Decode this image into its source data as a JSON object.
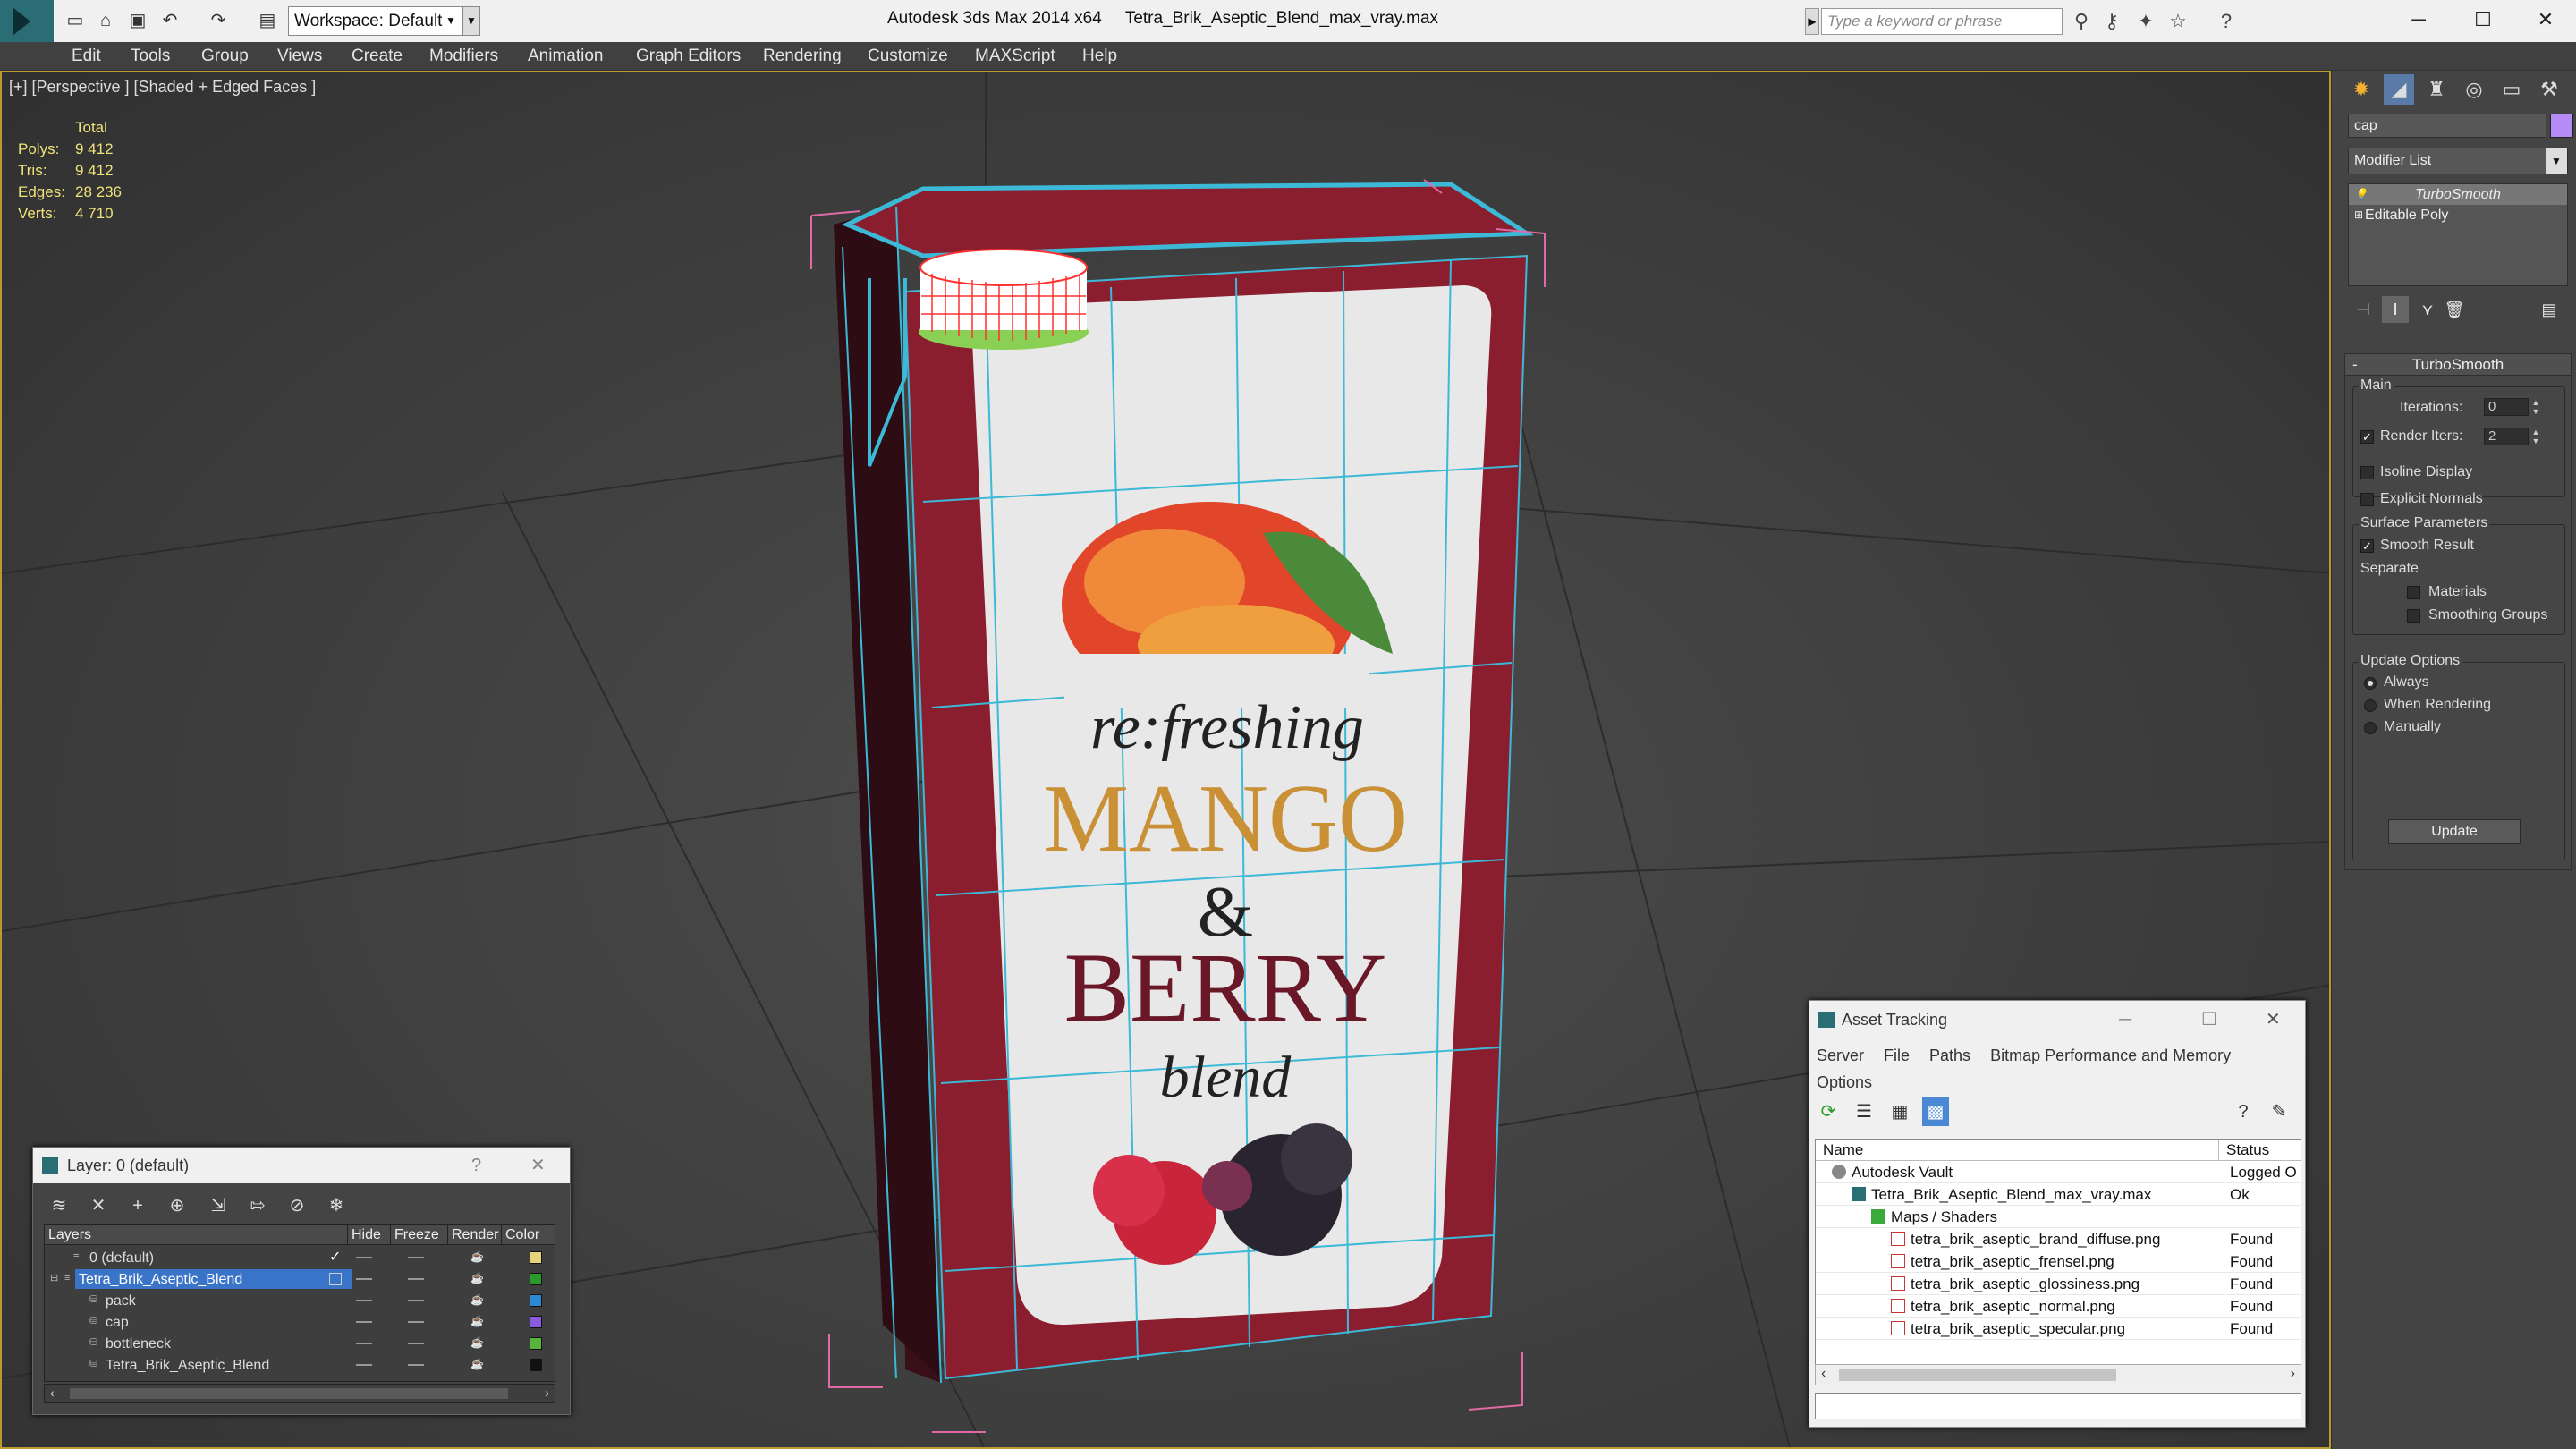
{
  "app": {
    "title": "Autodesk 3ds Max 2014 x64     Tetra_Brik_Aseptic_Blend_max_vray.max",
    "workspace": "Workspace: Default",
    "search_placeholder": "Type a keyword or phrase"
  },
  "menu": [
    "Edit",
    "Tools",
    "Group",
    "Views",
    "Create",
    "Modifiers",
    "Animation",
    "Graph Editors",
    "Rendering",
    "Customize",
    "MAXScript",
    "Help"
  ],
  "viewport": {
    "label": "[+] [Perspective ] [Shaded + Edged Faces ]",
    "stats": {
      "header": "Total",
      "rows": [
        {
          "k": "Polys:",
          "v": "9 412"
        },
        {
          "k": "Tris:",
          "v": "9 412"
        },
        {
          "k": "Edges:",
          "v": "28 236"
        },
        {
          "k": "Verts:",
          "v": "4 710"
        }
      ]
    },
    "product": {
      "line1": "re:freshing",
      "line2": "MANGO",
      "line3": "&",
      "line4": "BERRY",
      "line5": "blend"
    }
  },
  "command_panel": {
    "object_name": "cap",
    "object_color": "#b58cf5",
    "modifier_list": "Modifier List",
    "stack": [
      "TurboSmooth",
      "Editable Poly"
    ],
    "rollout": {
      "title": "TurboSmooth",
      "main_label": "Main",
      "iterations_label": "Iterations:",
      "iterations_value": "0",
      "render_iters_label": "Render Iters:",
      "render_iters_value": "2",
      "isoline": "Isoline Display",
      "explicit": "Explicit Normals",
      "surface_label": "Surface Parameters",
      "smooth_result": "Smooth Result",
      "separate": "Separate",
      "materials": "Materials",
      "smoothing_groups": "Smoothing Groups",
      "update_options": "Update Options",
      "always": "Always",
      "when_rendering": "When Rendering",
      "manually": "Manually",
      "update_button": "Update"
    }
  },
  "layer_dialog": {
    "title": "Layer: 0 (default)",
    "columns": {
      "layers": "Layers",
      "hide": "Hide",
      "freeze": "Freeze",
      "render": "Render",
      "color": "Color"
    },
    "rows": [
      {
        "name": "0 (default)",
        "color": "#e6d37a"
      },
      {
        "name": "Tetra_Brik_Aseptic_Blend",
        "color": "#2a9a2a"
      },
      {
        "name": "pack",
        "color": "#2a8ad4"
      },
      {
        "name": "cap",
        "color": "#8a5ae0"
      },
      {
        "name": "bottleneck",
        "color": "#56b43a"
      },
      {
        "name": "Tetra_Brik_Aseptic_Blend",
        "color": "#111111"
      }
    ]
  },
  "asset_dialog": {
    "title": "Asset Tracking",
    "menu": [
      "Server",
      "File",
      "Paths",
      "Bitmap Performance and Memory",
      "Options"
    ],
    "columns": {
      "name": "Name",
      "status": "Status"
    },
    "rows": [
      {
        "name": "Autodesk Vault",
        "status": "Logged O"
      },
      {
        "name": "Tetra_Brik_Aseptic_Blend_max_vray.max",
        "status": "Ok"
      },
      {
        "name": "Maps / Shaders",
        "status": ""
      },
      {
        "name": "tetra_brik_aseptic_brand_diffuse.png",
        "status": "Found"
      },
      {
        "name": "tetra_brik_aseptic_frensel.png",
        "status": "Found"
      },
      {
        "name": "tetra_brik_aseptic_glossiness.png",
        "status": "Found"
      },
      {
        "name": "tetra_brik_aseptic_normal.png",
        "status": "Found"
      },
      {
        "name": "tetra_brik_aseptic_specular.png",
        "status": "Found"
      }
    ]
  }
}
